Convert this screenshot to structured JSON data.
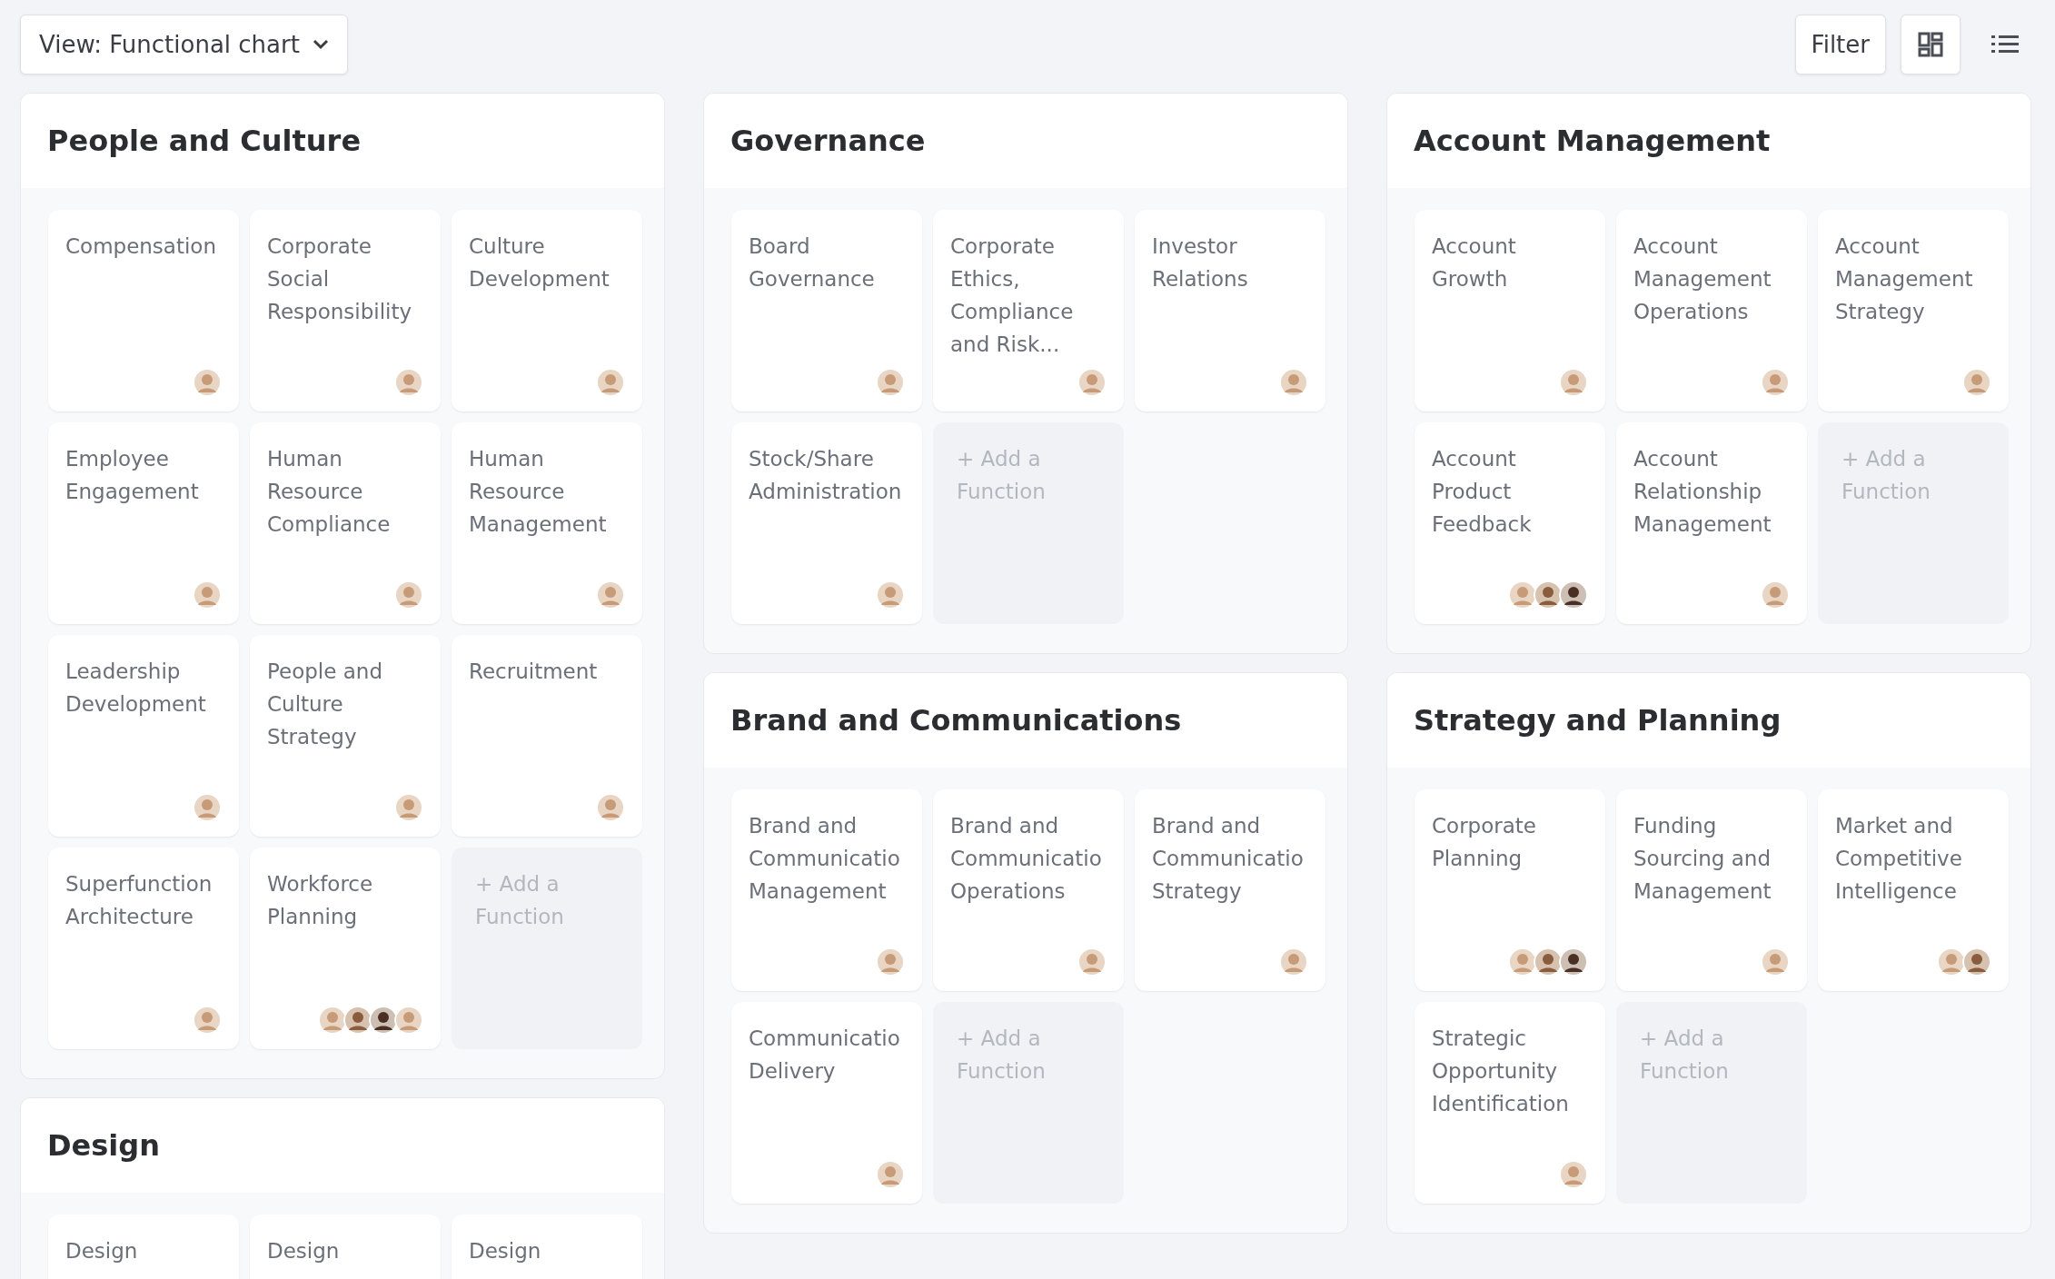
{
  "toolbar": {
    "view_select": "View: Functional chart",
    "filter_button": "Filter",
    "view_toggles": [
      {
        "kind": "grid",
        "selected": true
      },
      {
        "kind": "list",
        "selected": false
      }
    ]
  },
  "columns": [
    {
      "sections": [
        {
          "title": "People and Culture",
          "cards": [
            {
              "kind": "function",
              "title": "Compensation",
              "avatars": [
                {
                  "kind": "person"
                }
              ]
            },
            {
              "kind": "function",
              "title": "Corporate Social Responsibility",
              "avatars": [
                {
                  "kind": "person"
                }
              ]
            },
            {
              "kind": "function",
              "title": "Culture Development",
              "avatars": [
                {
                  "kind": "person"
                }
              ]
            },
            {
              "kind": "function",
              "title": "Employee Engagement",
              "avatars": [
                {
                  "kind": "person"
                }
              ]
            },
            {
              "kind": "function",
              "title": "Human Resource Compliance",
              "avatars": [
                {
                  "kind": "person"
                }
              ]
            },
            {
              "kind": "function",
              "title": "Human Resource Management",
              "avatars": [
                {
                  "kind": "person"
                }
              ]
            },
            {
              "kind": "function",
              "title": "Leadership Development",
              "avatars": [
                {
                  "kind": "person"
                }
              ]
            },
            {
              "kind": "function",
              "title": "People and Culture Strategy",
              "avatars": [
                {
                  "kind": "person"
                }
              ]
            },
            {
              "kind": "function",
              "title": "Recruitment",
              "avatars": [
                {
                  "kind": "person"
                }
              ]
            },
            {
              "kind": "function",
              "title": "Superfunction Architecture",
              "avatars": [
                {
                  "kind": "person"
                }
              ]
            },
            {
              "kind": "function",
              "title": "Workforce Planning",
              "avatars": [
                {
                  "kind": "person"
                },
                {
                  "kind": "person"
                },
                {
                  "kind": "person"
                },
                {
                  "kind": "person"
                }
              ]
            },
            {
              "kind": "add",
              "title": "+ Add a Function"
            }
          ]
        },
        {
          "title": "Design",
          "cards": [
            {
              "kind": "function",
              "title": "Design"
            },
            {
              "kind": "function",
              "title": "Design"
            },
            {
              "kind": "function",
              "title": "Design"
            }
          ]
        }
      ]
    },
    {
      "sections": [
        {
          "title": "Governance",
          "cards": [
            {
              "kind": "function",
              "title": "Board Governance",
              "avatars": [
                {
                  "kind": "person"
                }
              ]
            },
            {
              "kind": "function",
              "title": "Corporate Ethics, Compliance and Risk...",
              "avatars": [
                {
                  "kind": "person"
                }
              ]
            },
            {
              "kind": "function",
              "title": "Investor Relations",
              "avatars": [
                {
                  "kind": "person"
                }
              ]
            },
            {
              "kind": "function",
              "title": "Stock/Share Administration",
              "avatars": [
                {
                  "kind": "person"
                }
              ]
            },
            {
              "kind": "add",
              "title": "+ Add a Function"
            }
          ]
        },
        {
          "title": "Brand and Communications",
          "cards": [
            {
              "kind": "function",
              "title": "Brand and Communicatio Management",
              "avatars": [
                {
                  "kind": "person"
                }
              ]
            },
            {
              "kind": "function",
              "title": "Brand and Communicatio Operations",
              "avatars": [
                {
                  "kind": "person"
                }
              ]
            },
            {
              "kind": "function",
              "title": "Brand and Communicatio Strategy",
              "avatars": [
                {
                  "kind": "person"
                }
              ]
            },
            {
              "kind": "function",
              "title": "Communicatio Delivery",
              "avatars": [
                {
                  "kind": "person"
                }
              ]
            },
            {
              "kind": "add",
              "title": "+ Add a Function"
            }
          ]
        }
      ]
    },
    {
      "sections": [
        {
          "title": "Account Management",
          "cards": [
            {
              "kind": "function",
              "title": "Account Growth",
              "avatars": [
                {
                  "kind": "person"
                }
              ]
            },
            {
              "kind": "function",
              "title": "Account Management Operations",
              "avatars": [
                {
                  "kind": "person"
                }
              ]
            },
            {
              "kind": "function",
              "title": "Account Management Strategy",
              "avatars": [
                {
                  "kind": "person"
                }
              ]
            },
            {
              "kind": "function",
              "title": "Account Product Feedback",
              "avatars": [
                {
                  "kind": "person"
                },
                {
                  "kind": "person"
                },
                {
                  "kind": "person"
                }
              ]
            },
            {
              "kind": "function",
              "title": "Account Relationship Management",
              "avatars": [
                {
                  "kind": "person"
                }
              ]
            },
            {
              "kind": "add",
              "title": "+ Add a Function"
            }
          ]
        },
        {
          "title": "Strategy and Planning",
          "cards": [
            {
              "kind": "function",
              "title": "Corporate Planning",
              "avatars": [
                {
                  "kind": "person"
                },
                {
                  "kind": "person"
                },
                {
                  "kind": "person"
                }
              ]
            },
            {
              "kind": "function",
              "title": "Funding Sourcing and Management",
              "avatars": [
                {
                  "kind": "person"
                }
              ]
            },
            {
              "kind": "function",
              "title": "Market and Competitive Intelligence",
              "avatars": [
                {
                  "kind": "person"
                },
                {
                  "kind": "person"
                }
              ]
            },
            {
              "kind": "function",
              "title": "Strategic Opportunity Identification",
              "avatars": [
                {
                  "kind": "person"
                }
              ]
            },
            {
              "kind": "add",
              "title": "+ Add a Function"
            }
          ]
        }
      ]
    }
  ]
}
